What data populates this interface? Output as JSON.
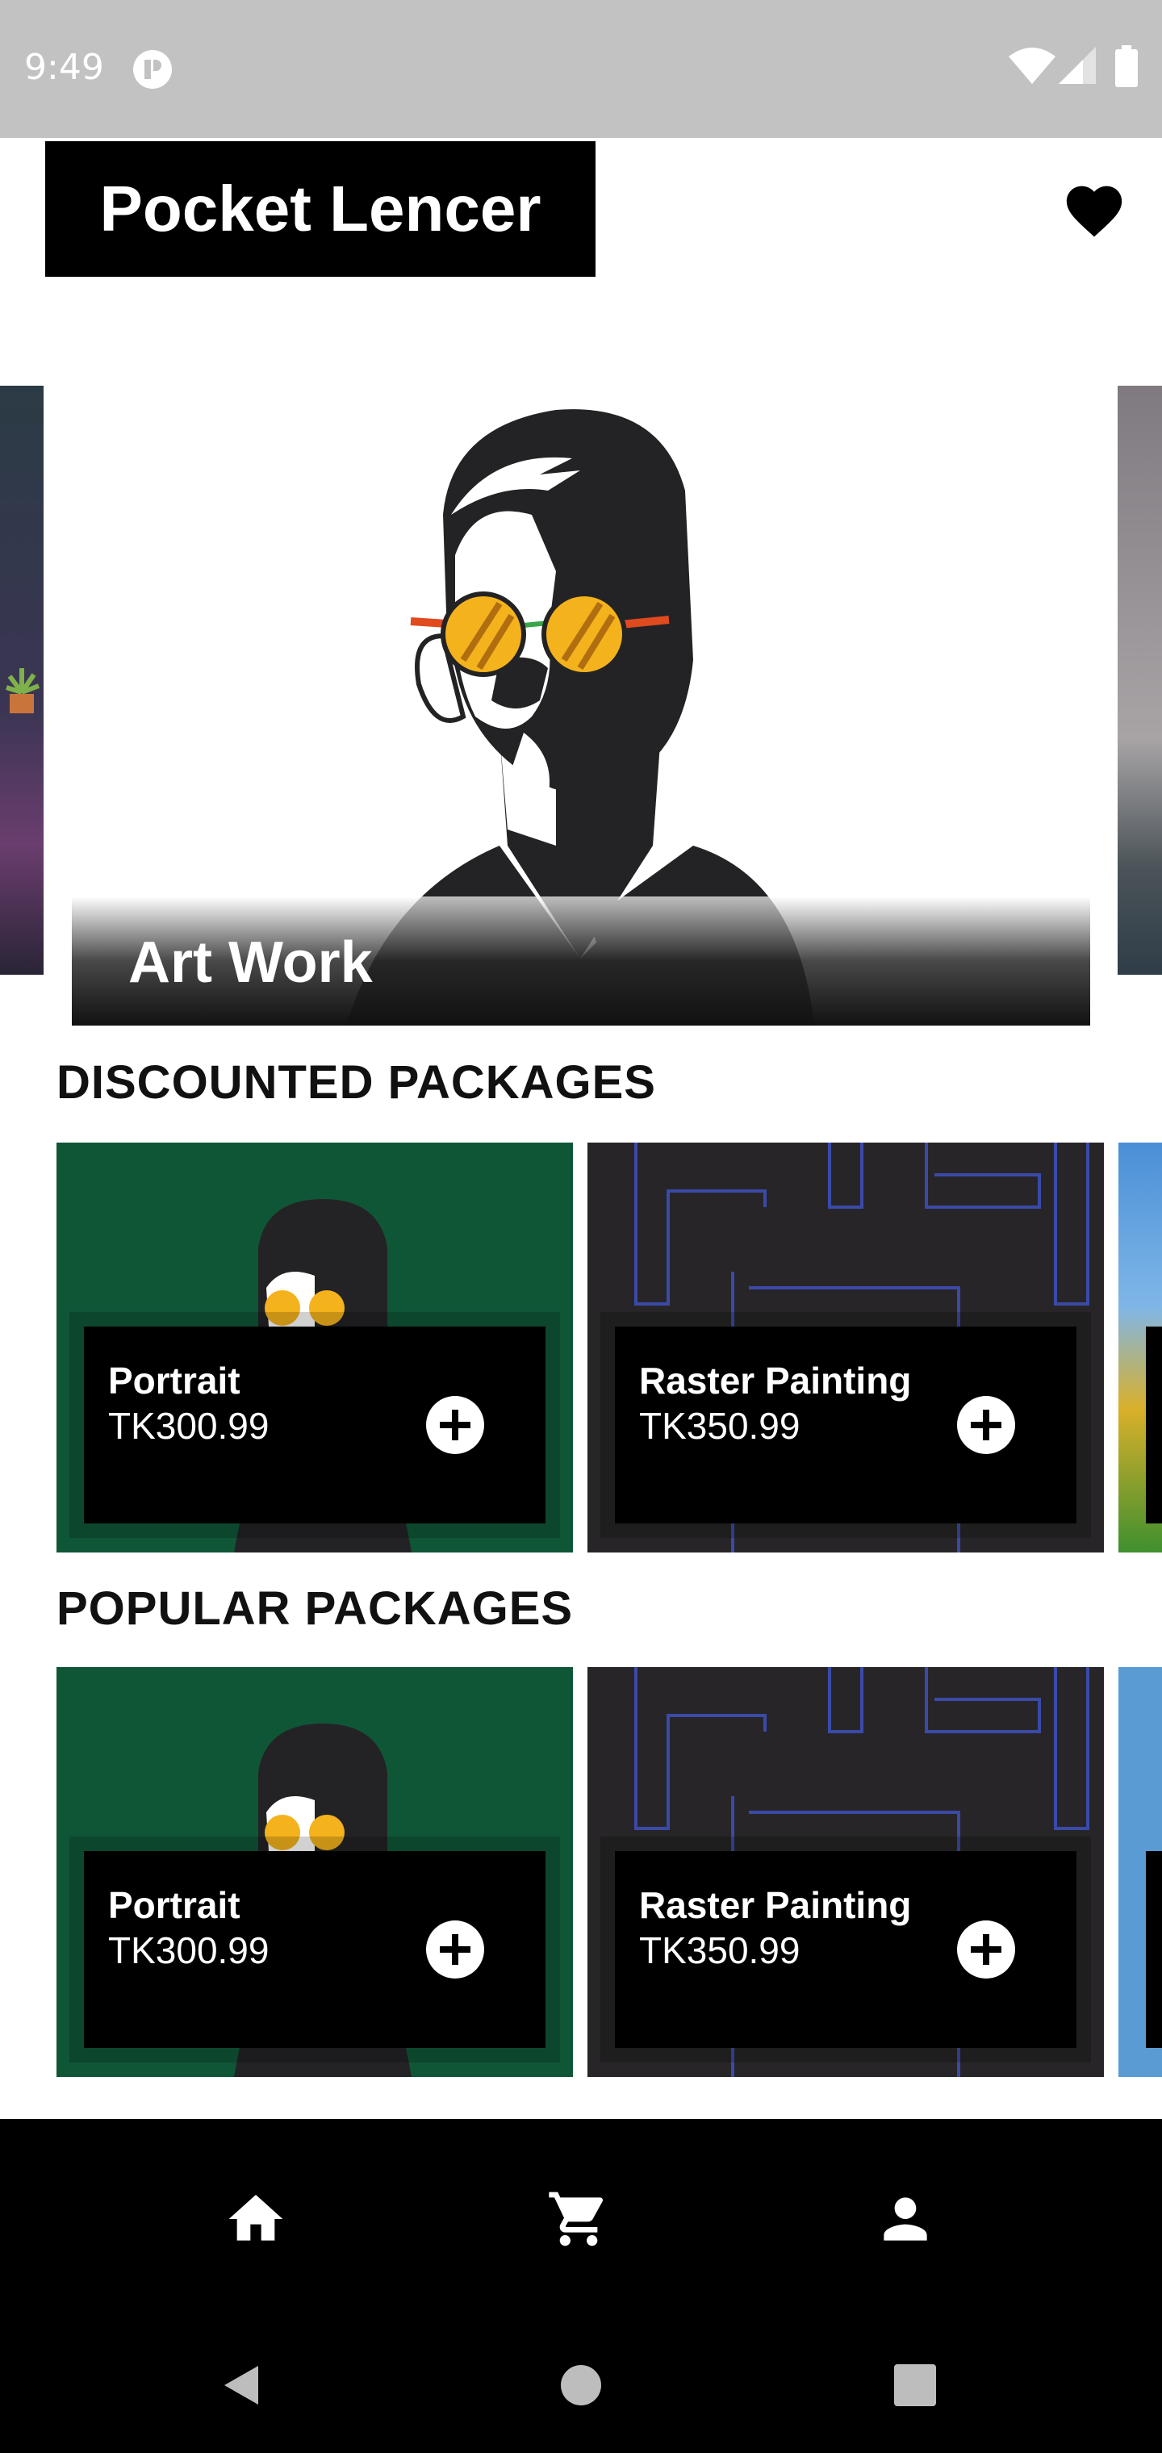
{
  "status_bar": {
    "time": "9:49"
  },
  "header": {
    "app_title": "Pocket Lencer",
    "favorite_icon": "heart-icon"
  },
  "hero": {
    "label": "Art Work"
  },
  "discounted": {
    "title": "DISCOUNTED PACKAGES",
    "items": [
      {
        "name": "Portrait",
        "price": "TK300.99"
      },
      {
        "name": "Raster Painting",
        "price": "TK350.99"
      }
    ]
  },
  "popular": {
    "title": "POPULAR PACKAGES",
    "items": [
      {
        "name": "Portrait",
        "price": "TK300.99"
      },
      {
        "name": "Raster Painting",
        "price": "TK350.99"
      }
    ]
  },
  "bottom_nav": {
    "icons": [
      "home-icon",
      "cart-icon",
      "profile-icon"
    ]
  },
  "system_nav": {
    "icons": [
      "back-icon",
      "home-circle-icon",
      "recents-icon"
    ]
  },
  "colors": {
    "accent": "#000000",
    "card_green": "#0f5637",
    "card_dark": "#272527",
    "status_bar": "#c2c2c2"
  }
}
